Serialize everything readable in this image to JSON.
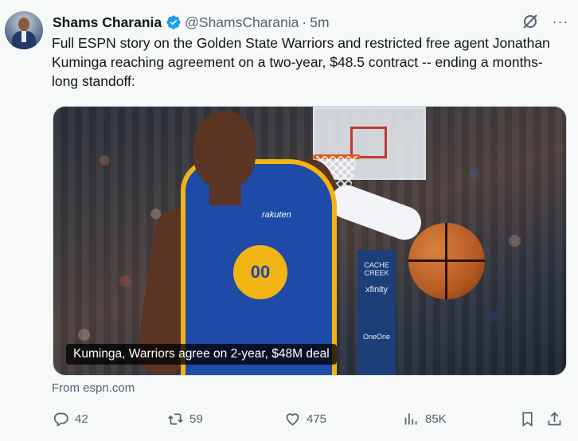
{
  "author": {
    "name": "Shams Charania",
    "handle": "@ShamsCharania",
    "separator": "·",
    "time": "5m"
  },
  "tweet": {
    "text": "Full ESPN story on the Golden State Warriors and restricted free agent Jonathan Kuminga reaching agreement on a two-year, $48.5 contract -- ending a months-long standoff:"
  },
  "media": {
    "caption": "Kuminga, Warriors agree on 2-year, $48M deal",
    "jersey_wordmark": "rakuten",
    "jersey_number": "00",
    "pole_text": [
      "CACHE CREEK",
      "xfinity",
      "OneOne"
    ]
  },
  "link_source": "From espn.com",
  "actions": {
    "replies": "42",
    "reposts": "59",
    "likes": "475",
    "views": "85K"
  },
  "colors": {
    "verified": "#1d9bf0",
    "text_secondary": "#536471",
    "warriors_blue": "#1e4aa8",
    "warriors_gold": "#f2b413"
  },
  "icons": [
    "grok-icon",
    "more-icon",
    "reply-icon",
    "retweet-icon",
    "like-icon",
    "views-icon",
    "bookmark-icon",
    "share-icon",
    "verified-badge-icon"
  ]
}
